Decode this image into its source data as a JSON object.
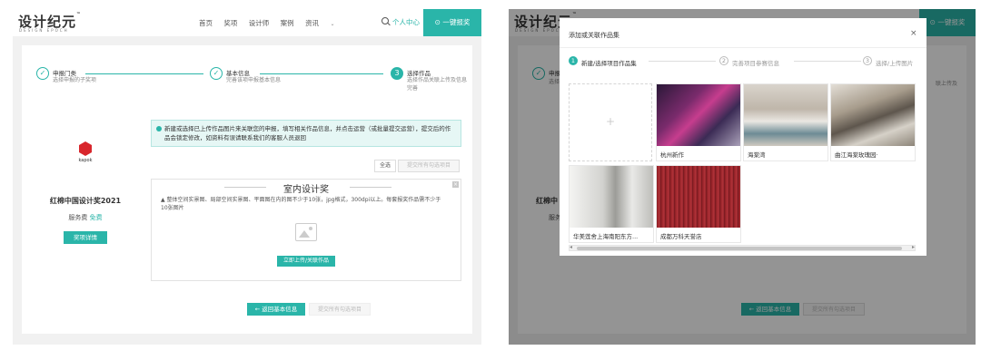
{
  "brand": {
    "name": "设计纪元",
    "tm": "™",
    "sub": "DESIGN EPOCH"
  },
  "nav": {
    "items": [
      "首页",
      "奖项",
      "设计师",
      "案例"
    ],
    "news": "资讯",
    "news_caret": "⌄"
  },
  "header": {
    "user_center": "个人中心",
    "submit_label": "一键报奖",
    "submit_icon": "⊙"
  },
  "steps": [
    {
      "num": "✓",
      "title": "申报门类",
      "desc": "选择申报的子奖项"
    },
    {
      "num": "✓",
      "title": "基本信息",
      "desc": "完善该项申报基本信息"
    },
    {
      "num": "3",
      "title": "选择作品",
      "desc": "选择作品关联上传及信息完善"
    }
  ],
  "award": {
    "logo_text": "kapok",
    "name": "红棉中国设计奖2021",
    "fee_label": "服务费",
    "fee_value": "免费",
    "detail_button": "奖项详情"
  },
  "notice": {
    "text": "新建或选择已上传作品图片来关联您的申报，填写相关作品信息，并点击运营（或批量提交运营），提交后的作品会锁定修改，如资料有误请联系我们的客服人员退回"
  },
  "actions": {
    "select_all": "全选",
    "submit_selected": "提交所有勾选项目",
    "back": "← 返回基本信息",
    "bottom_submit": "提交所有勾选项目"
  },
  "upload": {
    "title": "室内设计奖",
    "warning_icon": "▲",
    "warning": "整体空间实景图、局部空间实景图、平面图在内的图不少于10张，jpg格式，300dpi以上。每套报奖作品需不少于10张图片",
    "button": "立即上传/关联作品",
    "close": "×"
  },
  "modal": {
    "title": "添加或关联作品集",
    "close": "×",
    "steps": [
      {
        "num": "1",
        "label": "新建/选择项目作品集"
      },
      {
        "num": "2",
        "label": "完善项目参赛信息"
      },
      {
        "num": "3",
        "label": "选择/上传图片"
      }
    ],
    "add_symbol": "+",
    "works": [
      {
        "label": "杭州新作"
      },
      {
        "label": "海棠湾"
      },
      {
        "label": "曲江海棠玫瑰园·"
      },
      {
        "label": "华美莲舍上海南阳东方..."
      },
      {
        "label": "成都万科天誉店"
      }
    ],
    "scroll_left": "◂",
    "scroll_right": "▸"
  },
  "bg_right": {
    "side_fragment": "申报",
    "side_fragment2": "选择",
    "award_fragment": "红棉中",
    "fee_fragment": "服务",
    "right_fragment": "联上传及",
    "submit_fragment": "一键报奖"
  },
  "colors": {
    "accent": "#2ab5a9",
    "brand_red": "#d8262c"
  }
}
